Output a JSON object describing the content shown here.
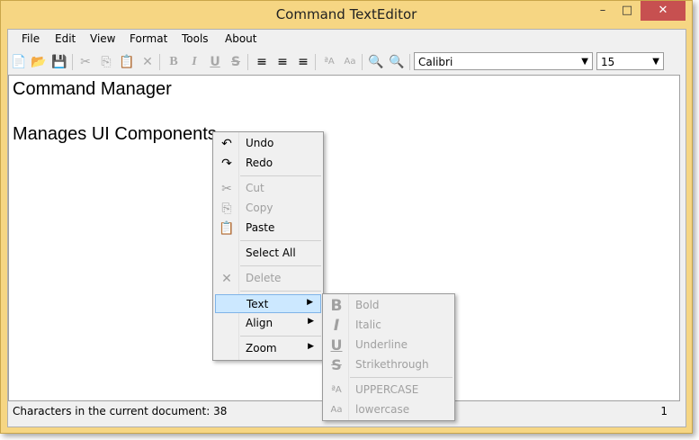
{
  "window": {
    "title": "Command TextEditor",
    "min": "–",
    "max": "□",
    "close": "✕"
  },
  "menubar": [
    "File",
    "Edit",
    "View",
    "Format",
    "Tools",
    "About"
  ],
  "toolbar": {
    "new_icon": "📄",
    "open_icon": "📂",
    "save_icon": "💾",
    "cut_icon": "✂",
    "copy_icon": "⎘",
    "paste_icon": "📋",
    "delete_icon": "✕",
    "bold_icon": "B",
    "italic_icon": "I",
    "underline_icon": "U",
    "strike_icon": "S",
    "align_left_icon": "≡",
    "align_center_icon": "≡",
    "align_right_icon": "≡",
    "upper_icon": "ªA",
    "lower_icon": "Aa",
    "zoom_in_icon": "🔍",
    "zoom_out_icon": "🔍",
    "font_family": "Calibri",
    "font_size": "15",
    "dropdown_arrow": "▼"
  },
  "document": {
    "line1": "Command Manager",
    "line2": "Manages UI Components"
  },
  "status": {
    "text": "Characters in the current document: 38",
    "number": "1"
  },
  "context_menu": {
    "undo": "Undo",
    "redo": "Redo",
    "cut": "Cut",
    "copy": "Copy",
    "paste": "Paste",
    "select_all": "Select All",
    "delete": "Delete",
    "text": "Text",
    "align": "Align",
    "zoom": "Zoom",
    "submenu_arrow": "▶",
    "undo_icon": "↶",
    "redo_icon": "↷",
    "cut_icon": "✂",
    "copy_icon": "⎘",
    "paste_icon": "📋",
    "delete_icon": "✕"
  },
  "text_submenu": {
    "bold": "Bold",
    "italic": "Italic",
    "underline": "Underline",
    "strikethrough": "Strikethrough",
    "uppercase": "UPPERCASE",
    "lowercase": "lowercase",
    "bold_icon": "B",
    "italic_icon": "I",
    "underline_icon": "U",
    "strike_icon": "S",
    "upper_icon": "ªA",
    "lower_icon": "Aa"
  }
}
